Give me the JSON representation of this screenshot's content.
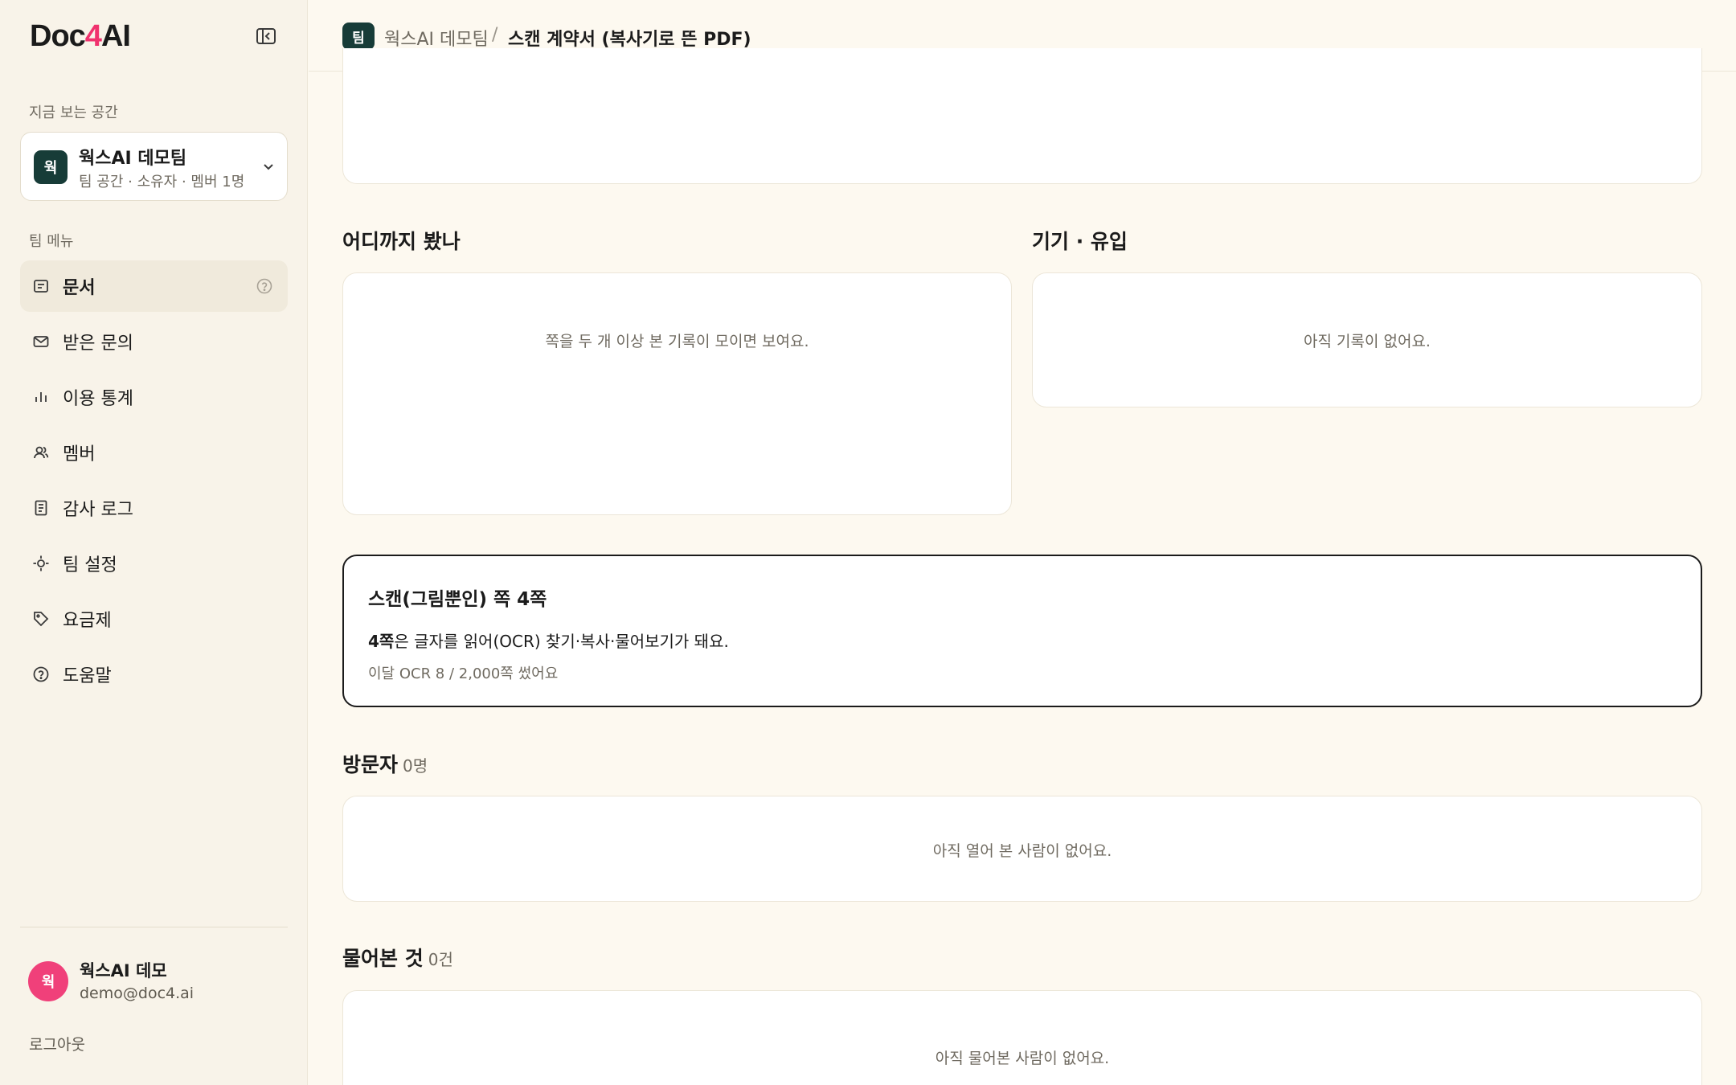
{
  "app": {
    "logo_prefix": "Doc",
    "logo_accent": "4",
    "logo_suffix": "AI"
  },
  "sidebar": {
    "space_label": "지금 보는 공간",
    "space": {
      "avatar": "웍",
      "name": "웍스AI 데모팀",
      "sub": "팀 공간 · 소유자 · 멤버 1명"
    },
    "menu_label": "팀 메뉴",
    "items": [
      {
        "label": "문서",
        "icon": "document-icon",
        "active": true
      },
      {
        "label": "받은 문의",
        "icon": "mail-icon"
      },
      {
        "label": "이용 통계",
        "icon": "bar-chart-icon"
      },
      {
        "label": "멤버",
        "icon": "members-icon"
      },
      {
        "label": "감사 로그",
        "icon": "audit-log-icon"
      },
      {
        "label": "팀 설정",
        "icon": "settings-icon"
      },
      {
        "label": "요금제",
        "icon": "tag-icon"
      },
      {
        "label": "도움말",
        "icon": "help-icon"
      }
    ],
    "user": {
      "avatar": "웍",
      "name": "웍스AI 데모",
      "email": "demo@doc4.ai"
    },
    "logout": "로그아웃"
  },
  "header": {
    "badge": "팀",
    "space": "웍스AI 데모팀",
    "separator": "/",
    "current": "스캔 계약서 (복사기로 뜬 PDF)"
  },
  "main": {
    "progress": {
      "title": "어디까지 봤나",
      "empty": "쪽을 두 개 이상 본 기록이 모이면 보여요."
    },
    "device": {
      "title": "기기 · 유입",
      "empty": "아직 기록이 없어요."
    },
    "ocr": {
      "title": "스캔(그림뿐인) 쪽 4쪽",
      "desc_bold": "4쪽",
      "desc_rest": "은 글자를 읽어(OCR) 찾기·복사·물어보기가 돼요.",
      "usage": "이달 OCR 8 / 2,000쪽 썼어요"
    },
    "visitors": {
      "title": "방문자",
      "count": "0명",
      "empty": "아직 열어 본 사람이 없어요."
    },
    "questions": {
      "title": "물어본 것",
      "count": "0건",
      "empty": "아직 물어본 사람이 없어요."
    }
  }
}
